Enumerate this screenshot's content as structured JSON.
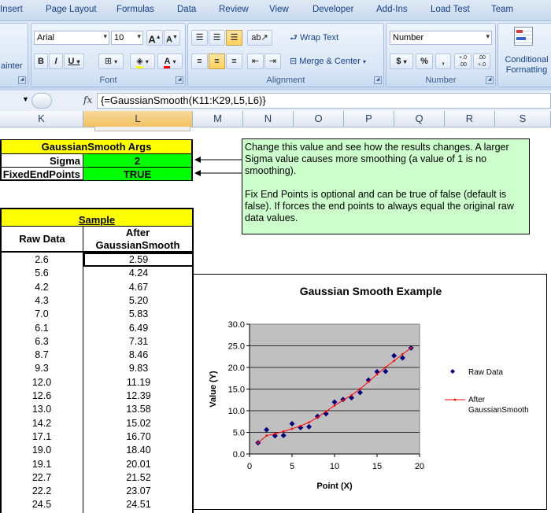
{
  "ribbon_tabs": [
    "Insert",
    "Page Layout",
    "Formulas",
    "Data",
    "Review",
    "View",
    "Developer",
    "Add-Ins",
    "Load Test",
    "Team"
  ],
  "clipboard": {
    "painter_label": "ainter"
  },
  "font": {
    "name": "Arial",
    "size": "10",
    "group_label": "Font",
    "bold": "B",
    "italic": "I",
    "underline": "U",
    "grow": "A",
    "shrink": "A",
    "color_a": "A"
  },
  "alignment": {
    "wrap_text": "Wrap Text",
    "merge_center": "Merge & Center",
    "group_label": "Alignment"
  },
  "number": {
    "format": "Number",
    "group_label": "Number",
    "currency": "$",
    "percent": "%",
    "comma": ",",
    "inc_decimal": "+.0 .00",
    "dec_decimal": ".00 +.0"
  },
  "styles": {
    "conditional": "Conditional",
    "formatting": "Formatting"
  },
  "formula_bar": {
    "fx": "fx",
    "formula": "{=GaussianSmooth(K11:K29,L5,L6)}"
  },
  "columns": [
    "K",
    "L",
    "M",
    "N",
    "O",
    "P",
    "Q",
    "R",
    "S"
  ],
  "args": {
    "header": "GaussianSmooth Args",
    "sigma_label": "Sigma",
    "sigma_value": "2",
    "fixed_label": "FixedEndPoints",
    "fixed_value": "TRUE"
  },
  "note": {
    "para1": "Change this value and see how the results changes.  A larger Sigma value causes more smoothing (a value of 1 is no smoothing).",
    "para2": "Fix End Points is optional and can be true of false (default is false).  If forces the end points to always equal the original raw data values."
  },
  "sample": {
    "header": "Sample",
    "col1": "Raw Data",
    "col2a": "After",
    "col2b": "GaussianSmooth"
  },
  "rows": [
    {
      "raw": "2.6",
      "smooth": "2.59"
    },
    {
      "raw": "5.6",
      "smooth": "4.24"
    },
    {
      "raw": "4.2",
      "smooth": "4.67"
    },
    {
      "raw": "4.3",
      "smooth": "5.20"
    },
    {
      "raw": "7.0",
      "smooth": "5.83"
    },
    {
      "raw": "6.1",
      "smooth": "6.49"
    },
    {
      "raw": "6.3",
      "smooth": "7.31"
    },
    {
      "raw": "8.7",
      "smooth": "8.46"
    },
    {
      "raw": "9.3",
      "smooth": "9.83"
    },
    {
      "raw": "12.0",
      "smooth": "11.19"
    },
    {
      "raw": "12.6",
      "smooth": "12.39"
    },
    {
      "raw": "13.0",
      "smooth": "13.58"
    },
    {
      "raw": "14.2",
      "smooth": "15.02"
    },
    {
      "raw": "17.1",
      "smooth": "16.70"
    },
    {
      "raw": "19.0",
      "smooth": "18.40"
    },
    {
      "raw": "19.1",
      "smooth": "20.01"
    },
    {
      "raw": "22.7",
      "smooth": "21.52"
    },
    {
      "raw": "22.2",
      "smooth": "23.07"
    },
    {
      "raw": "24.5",
      "smooth": "24.51"
    }
  ],
  "chart_data": {
    "type": "scatter",
    "title": "Gaussian Smooth Example",
    "xlabel": "Point (X)",
    "ylabel": "Value (Y)",
    "xlim": [
      0,
      20
    ],
    "ylim": [
      0,
      30
    ],
    "xticks": [
      "0",
      "5",
      "10",
      "15",
      "20"
    ],
    "yticks": [
      "0.0",
      "5.0",
      "10.0",
      "15.0",
      "20.0",
      "25.0",
      "30.0"
    ],
    "grid": true,
    "legend": "right",
    "series": [
      {
        "name": "Raw Data",
        "kind": "markers",
        "color": "#000080",
        "x": [
          1,
          2,
          3,
          4,
          5,
          6,
          7,
          8,
          9,
          10,
          11,
          12,
          13,
          14,
          15,
          16,
          17,
          18,
          19
        ],
        "y": [
          2.6,
          5.6,
          4.2,
          4.3,
          7.0,
          6.1,
          6.3,
          8.7,
          9.3,
          12.0,
          12.6,
          13.0,
          14.2,
          17.1,
          19.0,
          19.1,
          22.7,
          22.2,
          24.5
        ]
      },
      {
        "name": "After GaussianSmooth",
        "kind": "line",
        "color": "#ff0000",
        "x": [
          1,
          2,
          3,
          4,
          5,
          6,
          7,
          8,
          9,
          10,
          11,
          12,
          13,
          14,
          15,
          16,
          17,
          18,
          19
        ],
        "y": [
          2.59,
          4.24,
          4.67,
          5.2,
          5.83,
          6.49,
          7.31,
          8.46,
          9.83,
          11.19,
          12.39,
          13.58,
          15.02,
          16.7,
          18.4,
          20.01,
          21.52,
          23.07,
          24.51
        ]
      }
    ]
  }
}
